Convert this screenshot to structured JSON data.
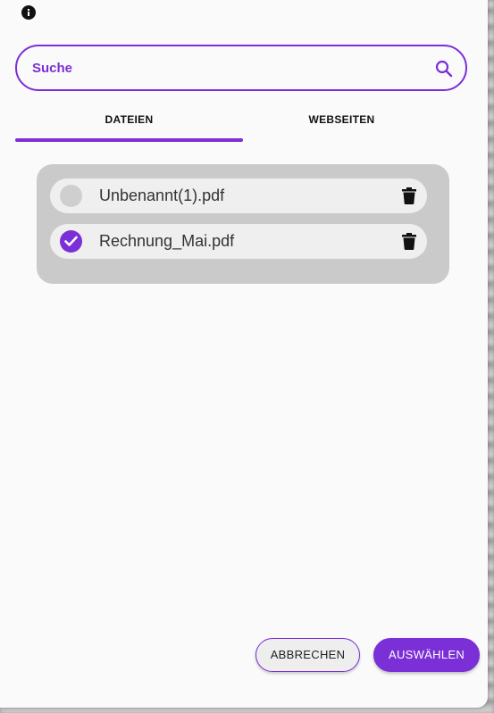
{
  "search": {
    "placeholder": "Suche",
    "value": ""
  },
  "tabs": [
    {
      "label": "DATEIEN",
      "active": true
    },
    {
      "label": "WEBSEITEN",
      "active": false
    }
  ],
  "files": [
    {
      "name": "Unbenannt(1).pdf",
      "selected": false
    },
    {
      "name": "Rechnung_Mai.pdf",
      "selected": true
    }
  ],
  "buttons": {
    "cancel": "ABBRECHEN",
    "select": "AUSWÄHLEN"
  },
  "colors": {
    "accent": "#7b2fd6",
    "panel": "#cacaca"
  },
  "icons": {
    "info": "info-icon",
    "search": "search-icon",
    "check": "check-icon",
    "delete": "trash-icon"
  }
}
